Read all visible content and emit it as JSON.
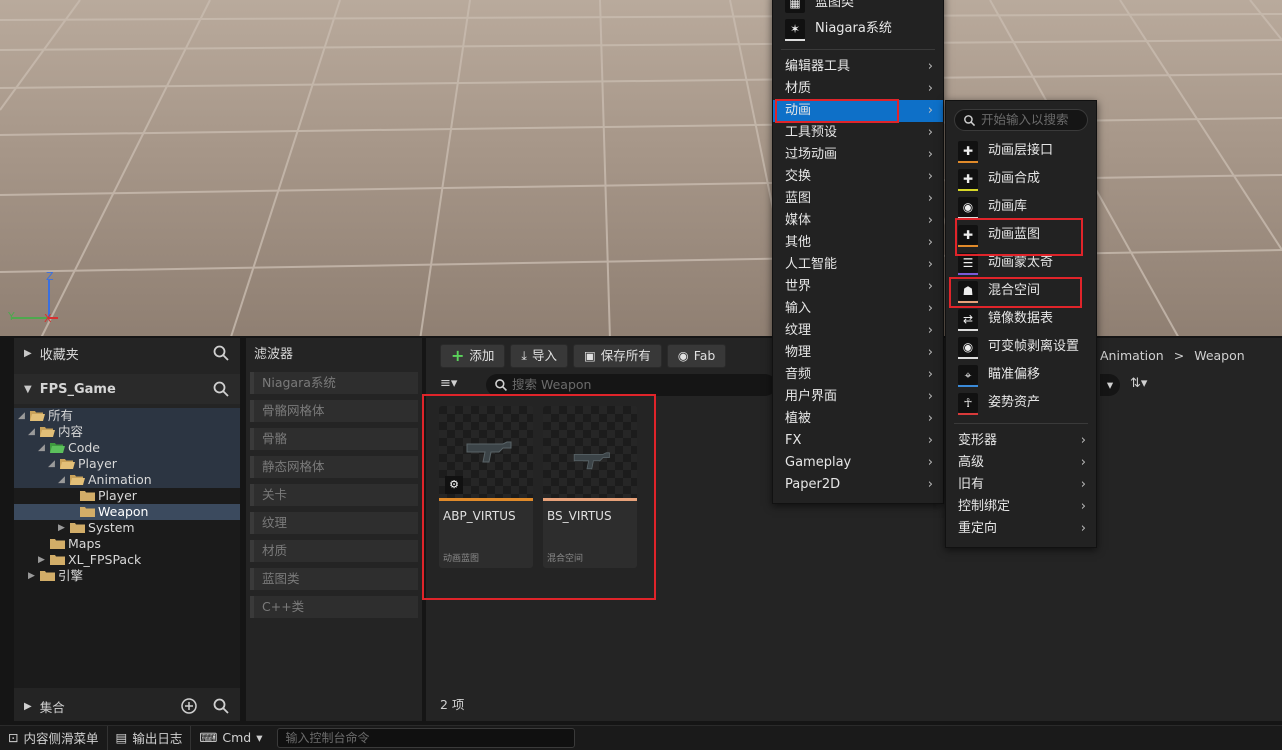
{
  "viewport": {
    "axis_z": "Z",
    "axis_y": "Y",
    "axis_x": "X"
  },
  "sidebar": {
    "favorites": "收藏夹",
    "project": "FPS_Game",
    "tree": [
      {
        "label": "所有"
      },
      {
        "label": "内容"
      },
      {
        "label": "Code"
      },
      {
        "label": "Player"
      },
      {
        "label": "Animation"
      },
      {
        "label": "Player"
      },
      {
        "label": "Weapon"
      },
      {
        "label": "System"
      },
      {
        "label": "Maps"
      },
      {
        "label": "XL_FPSPack"
      },
      {
        "label": "引擎"
      }
    ],
    "collections": "集合"
  },
  "filters": {
    "title": "滤波器",
    "items": [
      "Niagara系统",
      "骨骼网格体",
      "骨骼",
      "静态网格体",
      "关卡",
      "纹理",
      "材质",
      "蓝图类",
      "C++类"
    ]
  },
  "toolbar": {
    "add": "添加",
    "import": "导入",
    "save_all": "保存所有",
    "fab": "Fab"
  },
  "search": {
    "placeholder": "搜索 Weapon"
  },
  "breadcrumb": {
    "part1": "Animation",
    "sep": ">",
    "part2": "Weapon"
  },
  "assets": [
    {
      "name": "ABP_VIRTUS",
      "type": "动画蓝图",
      "color": "#e08a2a"
    },
    {
      "name": "BS_VIRTUS",
      "type": "混合空间",
      "color": "#e8a27a"
    }
  ],
  "item_count": "2 项",
  "status_bar": {
    "content_drawer": "内容侧滑菜单",
    "output_log": "输出日志",
    "cmd": "Cmd",
    "cmd_placeholder": "输入控制台命令"
  },
  "main_menu": {
    "top_items": [
      "蓝图类",
      "Niagara系统"
    ],
    "items": [
      {
        "label": "编辑器工具"
      },
      {
        "label": "材质"
      },
      {
        "label": "动画"
      },
      {
        "label": "工具预设"
      },
      {
        "label": "过场动画"
      },
      {
        "label": "交换"
      },
      {
        "label": "蓝图"
      },
      {
        "label": "媒体"
      },
      {
        "label": "其他"
      },
      {
        "label": "人工智能"
      },
      {
        "label": "世界"
      },
      {
        "label": "输入"
      },
      {
        "label": "纹理"
      },
      {
        "label": "物理"
      },
      {
        "label": "音频"
      },
      {
        "label": "用户界面"
      },
      {
        "label": "植被"
      },
      {
        "label": "FX"
      },
      {
        "label": "Gameplay"
      },
      {
        "label": "Paper2D"
      }
    ],
    "active": "动画"
  },
  "anim_menu": {
    "search_placeholder": "开始输入以搜索",
    "items": [
      {
        "label": "动画层接口",
        "icon": "anim-layer-icon",
        "color": "#e08a2a"
      },
      {
        "label": "动画合成",
        "icon": "anim-composite-icon",
        "color": "#d8d828"
      },
      {
        "label": "动画库",
        "icon": "anim-library-icon",
        "color": "#dddddd"
      },
      {
        "label": "动画蓝图",
        "icon": "anim-blueprint-icon",
        "color": "#e08a2a"
      },
      {
        "label": "动画蒙太奇",
        "icon": "anim-montage-icon",
        "color": "#7a5ad8"
      },
      {
        "label": "混合空间",
        "icon": "blend-space-icon",
        "color": "#e8a27a"
      },
      {
        "label": "镜像数据表",
        "icon": "mirror-table-icon",
        "color": "#dddddd"
      },
      {
        "label": "可变帧剥离设置",
        "icon": "frame-strip-icon",
        "color": "#dddddd"
      },
      {
        "label": "瞄准偏移",
        "icon": "aim-offset-icon",
        "color": "#3a8ad8"
      },
      {
        "label": "姿势资产",
        "icon": "pose-asset-icon",
        "color": "#d83a3a"
      }
    ],
    "more": [
      "变形器",
      "高级",
      "旧有",
      "控制绑定",
      "重定向"
    ]
  }
}
